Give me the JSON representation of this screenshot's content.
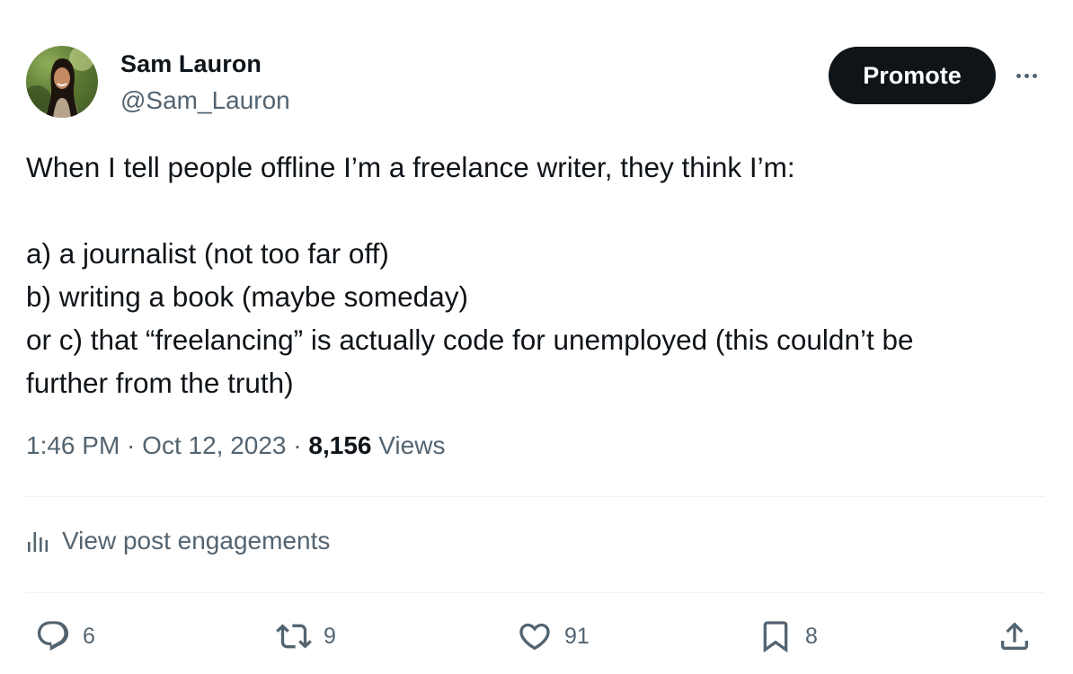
{
  "author": {
    "display_name": "Sam Lauron",
    "handle": "@Sam_Lauron",
    "avatar_icon": "profile-photo"
  },
  "header": {
    "promote_label": "Promote",
    "more_icon": "more-horizontal-icon"
  },
  "tweet": {
    "lines": [
      "When I tell people offline I’m a freelance writer, they think I’m:",
      "",
      "a) a journalist (not too far off)",
      "b) writing a book (maybe someday)",
      "or c) that “freelancing” is actually code for unemployed (this couldn’t be",
      "further from the truth)"
    ]
  },
  "meta": {
    "time": "1:46 PM",
    "separator": " · ",
    "date": "Oct 12, 2023",
    "views_count": "8,156",
    "views_label": "Views"
  },
  "engagements": {
    "label": "View post engagements",
    "icon": "bar-chart-icon"
  },
  "actions": {
    "replies": "6",
    "reposts": "9",
    "likes": "91",
    "bookmarks": "8"
  },
  "colors": {
    "text": "#0f1419",
    "secondary": "#536471",
    "divider": "#eff3f4",
    "button": "#0f1419"
  }
}
